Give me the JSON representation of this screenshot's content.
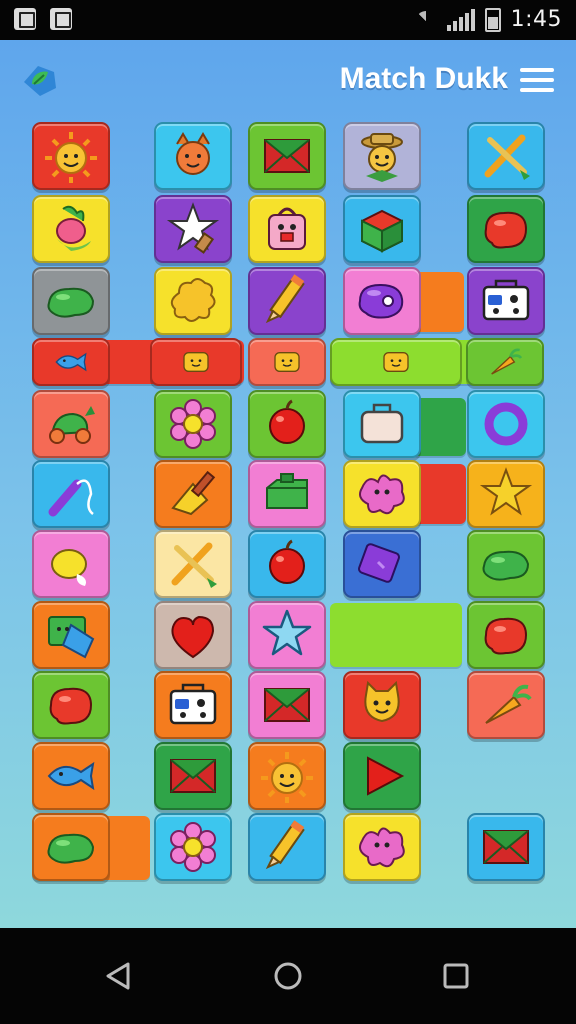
{
  "status_bar": {
    "time": "1:45"
  },
  "header": {
    "title": "Match Dukk",
    "logo_icon": "leaf-logo-icon",
    "menu_icon": "hamburger-menu-icon"
  },
  "colors": {
    "background_top": "#5fa6ec",
    "background_bottom": "#8ed8dc",
    "title": "#ffffff"
  },
  "board": {
    "tiles": [
      {
        "id": "r1c1",
        "color": "#e8392a",
        "icon": "sun"
      },
      {
        "id": "r1c2",
        "color": "#3cc6ee",
        "icon": "animal-face"
      },
      {
        "id": "r1c3",
        "color": "#6cc533",
        "icon": "envelope"
      },
      {
        "id": "r1c4",
        "color": "#b1b3d8",
        "icon": "farmer-face"
      },
      {
        "id": "r1c5",
        "color": "#39b8ec",
        "icon": "crossed-tools"
      },
      {
        "id": "r2c1",
        "color": "#f6e12b",
        "icon": "radish"
      },
      {
        "id": "r2c2",
        "color": "#8a43cc",
        "icon": "star-wand"
      },
      {
        "id": "r2c3",
        "color": "#f6e12b",
        "icon": "bag-face"
      },
      {
        "id": "r2c4",
        "color": "#39b8ec",
        "icon": "cube"
      },
      {
        "id": "r2c5",
        "color": "#2fa448",
        "icon": "red-blob"
      },
      {
        "id": "r3c1",
        "color": "#8f9497",
        "icon": "green-blob"
      },
      {
        "id": "r3c2",
        "color": "#f6e12b",
        "icon": "cloud-shape"
      },
      {
        "id": "r3c3",
        "color": "#8a43cc",
        "icon": "pencil"
      },
      {
        "id": "r3c4",
        "color": "#f27ed3",
        "icon": "purple-blob"
      },
      {
        "id": "r3c5",
        "color": "#8a43cc",
        "icon": "radio"
      },
      {
        "id": "r5c1",
        "color": "#f56a55",
        "icon": "turtle"
      },
      {
        "id": "r5c2",
        "color": "#6cc533",
        "icon": "flower"
      },
      {
        "id": "r5c3",
        "color": "#6cc533",
        "icon": "apple"
      },
      {
        "id": "r5c4",
        "color": "#3cc6ee",
        "icon": "suitcase"
      },
      {
        "id": "r5c5",
        "color": "#3cc6ee",
        "icon": "ring"
      },
      {
        "id": "r6c1",
        "color": "#39b8ec",
        "icon": "wand"
      },
      {
        "id": "r6c2",
        "color": "#f57c1e",
        "icon": "cheese-wand"
      },
      {
        "id": "r6c3",
        "color": "#f27ed3",
        "icon": "green-box"
      },
      {
        "id": "r6c4",
        "color": "#f6e12b",
        "icon": "pink-blob"
      },
      {
        "id": "r6c5",
        "color": "#f6b21b",
        "icon": "star"
      },
      {
        "id": "r7c1",
        "color": "#f27ed3",
        "icon": "lemon"
      },
      {
        "id": "r7c2",
        "color": "#fbe6a4",
        "icon": "crossed-tools"
      },
      {
        "id": "r7c3",
        "color": "#39b8ec",
        "icon": "apple"
      },
      {
        "id": "r7c4",
        "color": "#3a6fd4",
        "icon": "purple-card"
      },
      {
        "id": "r7c5",
        "color": "#6cc533",
        "icon": "green-blob"
      },
      {
        "id": "r8c1",
        "color": "#f57c1e",
        "icon": "flag-card"
      },
      {
        "id": "r8c2",
        "color": "#cdb8ad",
        "icon": "heart"
      },
      {
        "id": "r8c3",
        "color": "#f27ed3",
        "icon": "star-blue"
      },
      {
        "id": "r8c5",
        "color": "#6cc533",
        "icon": "red-blob"
      },
      {
        "id": "r9c1",
        "color": "#6cc533",
        "icon": "red-blob"
      },
      {
        "id": "r9c2",
        "color": "#f57c1e",
        "icon": "radio"
      },
      {
        "id": "r9c3",
        "color": "#f27ed3",
        "icon": "envelope"
      },
      {
        "id": "r9c4",
        "color": "#e8392a",
        "icon": "cat-face"
      },
      {
        "id": "r9c5",
        "color": "#f56a55",
        "icon": "carrot"
      },
      {
        "id": "r10c1",
        "color": "#f57c1e",
        "icon": "fish"
      },
      {
        "id": "r10c2",
        "color": "#2fa448",
        "icon": "envelope"
      },
      {
        "id": "r10c3",
        "color": "#f57c1e",
        "icon": "sun"
      },
      {
        "id": "r10c4",
        "color": "#2fa448",
        "icon": "play"
      },
      {
        "id": "r11c1",
        "color": "#f57c1e",
        "icon": "green-blob"
      },
      {
        "id": "r11c2",
        "color": "#3cc6ee",
        "icon": "flower"
      },
      {
        "id": "r11c3",
        "color": "#39b8ec",
        "icon": "pencil"
      },
      {
        "id": "r11c4",
        "color": "#f6e12b",
        "icon": "pink-blob"
      },
      {
        "id": "r11c5",
        "color": "#39b8ec",
        "icon": "envelope"
      }
    ],
    "bars": [
      {
        "id": "bar-r3",
        "color": "#f57c1e"
      },
      {
        "id": "bar-r4-red",
        "color": "#e8392a"
      },
      {
        "id": "bar-r4-green",
        "color": "#8ddd2f"
      },
      {
        "id": "bar-r5",
        "color": "#2fa448"
      },
      {
        "id": "bar-r6",
        "color": "#e8392a"
      },
      {
        "id": "bar-r8",
        "color": "#8ddd2f"
      },
      {
        "id": "bar-r11",
        "color": "#f57c1e"
      }
    ],
    "row4_tiles": [
      {
        "id": "r4c1",
        "color": "#e8392a",
        "icon": "fish"
      },
      {
        "id": "r4c2",
        "color": "#e8392a",
        "icon": "toast-face"
      },
      {
        "id": "r4c3",
        "color": "#f56a55",
        "icon": "toast-face"
      },
      {
        "id": "r4c4",
        "color": "#8ddd2f",
        "icon": "toast-face"
      },
      {
        "id": "r4c5",
        "color": "#6cc533",
        "icon": "carrot"
      }
    ]
  },
  "nav": {
    "back_icon": "back-triangle-icon",
    "home_icon": "home-circle-icon",
    "recents_icon": "recents-square-icon"
  }
}
